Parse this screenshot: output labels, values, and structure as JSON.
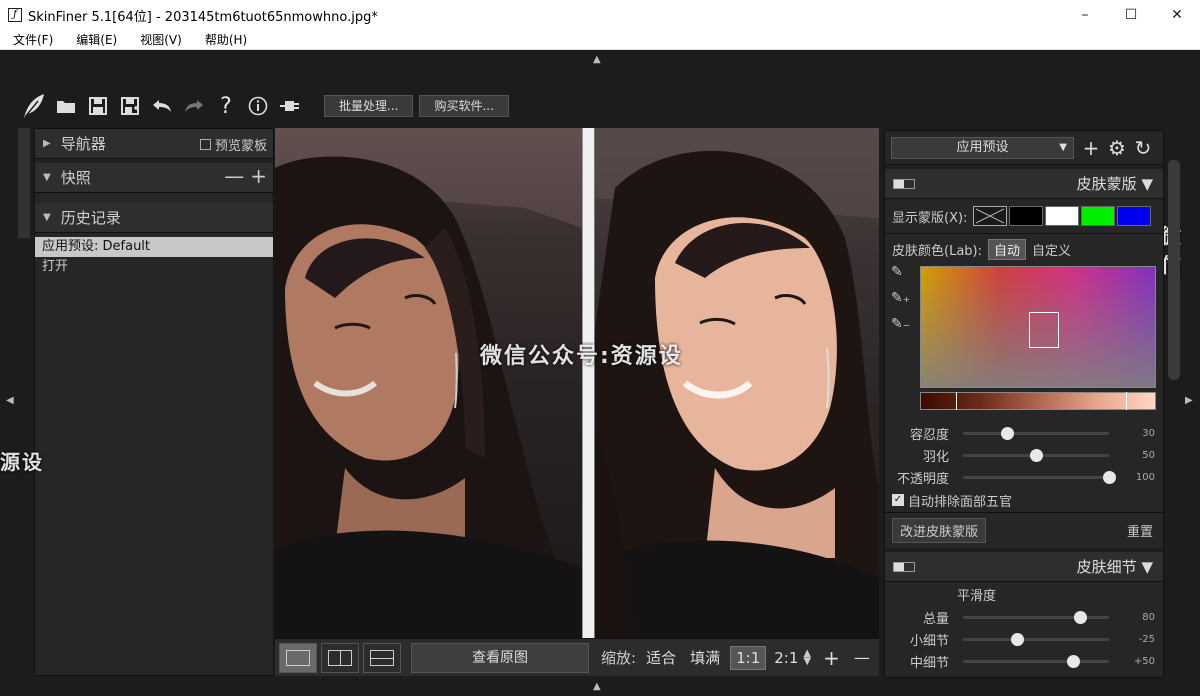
{
  "window": {
    "title": "SkinFiner 5.1[64位] - 203145tm6tuot65nmowhno.jpg*",
    "app_icon": "feather-icon",
    "controls": {
      "minimize": "–",
      "maximize": "☐",
      "close": "✕"
    }
  },
  "menu": [
    "文件(F)",
    "编辑(E)",
    "视图(V)",
    "帮助(H)"
  ],
  "toolbar": {
    "icons": [
      "logo-feather-icon",
      "open-folder-icon",
      "save-icon",
      "save-as-icon",
      "undo-icon",
      "redo-icon",
      "help-icon",
      "info-icon",
      "plugin-icon"
    ],
    "buttons": [
      "批量处理...",
      "购买软件..."
    ]
  },
  "left_panel": {
    "navigator": {
      "label": "导航器",
      "preview_mask": "预览蒙板"
    },
    "snapshot": {
      "label": "快照",
      "minus": "—",
      "plus": "+"
    },
    "history": {
      "label": "历史记录",
      "items": [
        "应用预设: Default",
        "打开"
      ]
    }
  },
  "canvas": {
    "watermark": "微信公众号:资源设",
    "watermark_edge_left": "源设",
    "watermark_edge_right": "微信"
  },
  "bottom_bar": {
    "view_modes": [
      "single",
      "split-vertical",
      "split-horizontal"
    ],
    "active_view": "single",
    "view_original": "查看原图",
    "zoom_label": "缩放:",
    "zoom_options": [
      "适合",
      "填满",
      "1:1",
      "2:1"
    ],
    "active_zoom": "1:1",
    "plus": "+",
    "minus": "—"
  },
  "right_panel": {
    "preset": {
      "label": "应用预设",
      "icons": [
        "add-icon",
        "gear-icon",
        "refresh-icon"
      ]
    },
    "skin_mask": {
      "title": "皮肤蒙版",
      "display_label": "显示蒙版(X):",
      "swatches": [
        "#1a1a1a",
        "#000000",
        "#ffffff",
        "#00ee00",
        "#0000ee"
      ],
      "color_label": "皮肤颜色(Lab):",
      "auto": "自动",
      "custom": "自定义",
      "sliders": [
        {
          "label": "容忍度",
          "value": 30,
          "percent": 30
        },
        {
          "label": "羽化",
          "value": 50,
          "percent": 50
        },
        {
          "label": "不透明度",
          "value": 100,
          "percent": 100
        }
      ],
      "auto_exclude": "自动排除面部五官",
      "improve_button": "改进皮肤蒙版",
      "reset": "重置"
    },
    "skin_detail": {
      "title": "皮肤细节",
      "smoothness": "平滑度",
      "sliders": [
        {
          "label": "总量",
          "value": 80,
          "percent": 80
        },
        {
          "label": "小细节",
          "value": -25,
          "percent": 37
        },
        {
          "label": "中细节",
          "value": "+50",
          "percent": 75
        }
      ]
    }
  }
}
